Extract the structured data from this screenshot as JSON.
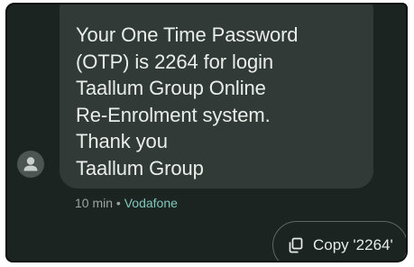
{
  "message": {
    "lines": [
      "Your One Time Password",
      "(OTP) is 2264 for login",
      "Taallum Group Online",
      "Re-Enrolment system.",
      "Thank you",
      "Taallum Group"
    ]
  },
  "meta": {
    "time": "10 min",
    "separator": " • ",
    "carrier": "Vodafone"
  },
  "avatar": {
    "icon": "person-icon"
  },
  "copy_action": {
    "label": "Copy '2264'",
    "icon": "copy-icon"
  },
  "colors": {
    "background": "#1c2422",
    "bubble": "#323a37",
    "carrier_accent": "#7fc8b8"
  }
}
